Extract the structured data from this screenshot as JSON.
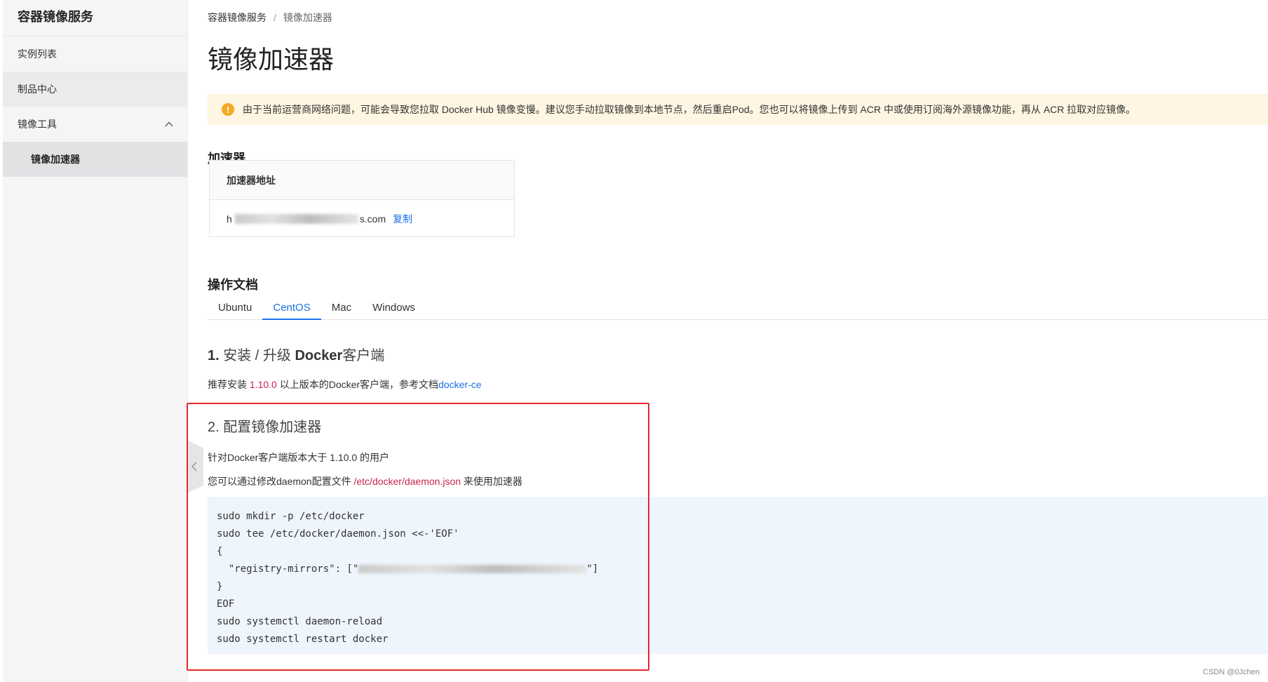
{
  "sidebar": {
    "title": "容器镜像服务",
    "items": [
      {
        "label": "实例列表"
      },
      {
        "label": "制品中心"
      },
      {
        "label": "镜像工具"
      },
      {
        "label": "镜像加速器"
      }
    ]
  },
  "breadcrumb": {
    "root": "容器镜像服务",
    "separator": "/",
    "current": "镜像加速器"
  },
  "page_title": "镜像加速器",
  "alert": {
    "icon": "!",
    "text": "由于当前运营商网络问题，可能会导致您拉取 Docker Hub 镜像变慢。建议您手动拉取镜像到本地节点，然后重启Pod。您也可以将镜像上传到 ACR 中或使用订阅海外源镜像功能，再从 ACR 拉取对应镜像。"
  },
  "accelerator": {
    "heading": "加速器",
    "column_header": "加速器地址",
    "address_prefix": "h",
    "address_suffix": "s.com",
    "copy_label": "复制"
  },
  "docs": {
    "heading": "操作文档",
    "tabs": [
      "Ubuntu",
      "CentOS",
      "Mac",
      "Windows"
    ],
    "active_tab": "CentOS"
  },
  "step1": {
    "num": "1.",
    "title_a": "安装 / 升级",
    "title_b": "Docker",
    "title_c": "客户端",
    "text_a": "推荐安装 ",
    "version": "1.10.0",
    "text_b": " 以上版本的Docker客户端，参考文档",
    "link": "docker-ce"
  },
  "step2": {
    "title": "2. 配置镜像加速器",
    "line1": "针对Docker客户端版本大于 1.10.0 的用户",
    "line2_a": "您可以通过修改daemon配置文件 ",
    "path": "/etc/docker/daemon.json",
    "line2_b": " 来使用加速器"
  },
  "code": {
    "lines": [
      "sudo mkdir -p /etc/docker",
      "sudo tee /etc/docker/daemon.json <<-'EOF'",
      "{",
      "  \"registry-mirrors\": [\"",
      "\"]",
      "}",
      "EOF",
      "sudo systemctl daemon-reload",
      "sudo systemctl restart docker"
    ]
  },
  "watermark": "CSDN @0Jchen",
  "colors": {
    "accent": "#1a73e8",
    "highlight_frame": "#e8262b",
    "warning": "#f7a924"
  }
}
